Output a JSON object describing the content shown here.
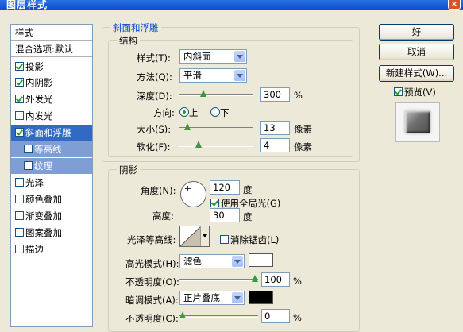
{
  "window": {
    "title": "图层样式",
    "close": "×"
  },
  "style_list": {
    "header": "样式",
    "items": [
      {
        "label": "混合选项:默认",
        "checkbox": false
      },
      {
        "label": "投影",
        "checkbox": true,
        "checked": true
      },
      {
        "label": "内阴影",
        "checkbox": true,
        "checked": true
      },
      {
        "label": "外发光",
        "checkbox": true,
        "checked": true
      },
      {
        "label": "内发光",
        "checkbox": true,
        "checked": false
      },
      {
        "label": "斜面和浮雕",
        "checkbox": true,
        "checked": true,
        "selected": true
      },
      {
        "label": "等高线",
        "checkbox": true,
        "checked": false,
        "sub": true
      },
      {
        "label": "纹理",
        "checkbox": true,
        "checked": false,
        "sub": true
      },
      {
        "label": "光泽",
        "checkbox": true,
        "checked": false
      },
      {
        "label": "颜色叠加",
        "checkbox": true,
        "checked": false
      },
      {
        "label": "渐变叠加",
        "checkbox": true,
        "checked": false
      },
      {
        "label": "图案叠加",
        "checkbox": true,
        "checked": false
      },
      {
        "label": "描边",
        "checkbox": true,
        "checked": false
      }
    ]
  },
  "bevel": {
    "section_title": "斜面和浮雕",
    "structure_title": "结构",
    "style_label": "样式(T):",
    "style_value": "内斜面",
    "technique_label": "方法(Q):",
    "technique_value": "平滑",
    "depth_label": "深度(D):",
    "depth_value": "300",
    "depth_unit": "%",
    "direction_label": "方向:",
    "direction_up": "上",
    "direction_down": "下",
    "direction_selected": "上",
    "size_label": "大小(S):",
    "size_value": "13",
    "size_unit": "像素",
    "soften_label": "软化(F):",
    "soften_value": "4",
    "soften_unit": "像素"
  },
  "shading": {
    "title": "阴影",
    "angle_label": "角度(N):",
    "angle_value": "120",
    "angle_unit": "度",
    "global_light_label": "使用全局光(G)",
    "global_light_checked": true,
    "altitude_label": "高度:",
    "altitude_value": "30",
    "altitude_unit": "度",
    "gloss_contour_label": "光泽等高线:",
    "antialias_label": "消除锯齿(L)",
    "antialias_checked": false,
    "highlight_mode_label": "高光模式(H):",
    "highlight_mode_value": "滤色",
    "highlight_color": "#ffffff",
    "highlight_opacity_label": "不透明度(O):",
    "highlight_opacity_value": "100",
    "highlight_opacity_unit": "%",
    "shadow_mode_label": "暗调模式(A):",
    "shadow_mode_value": "正片叠底",
    "shadow_color": "#000000",
    "shadow_opacity_label": "不透明度(C):",
    "shadow_opacity_value": "0",
    "shadow_opacity_unit": "%"
  },
  "buttons": {
    "ok": "好",
    "cancel": "取消",
    "new_style": "新建样式(W)...",
    "preview_label": "预览(V)",
    "preview_checked": true
  }
}
